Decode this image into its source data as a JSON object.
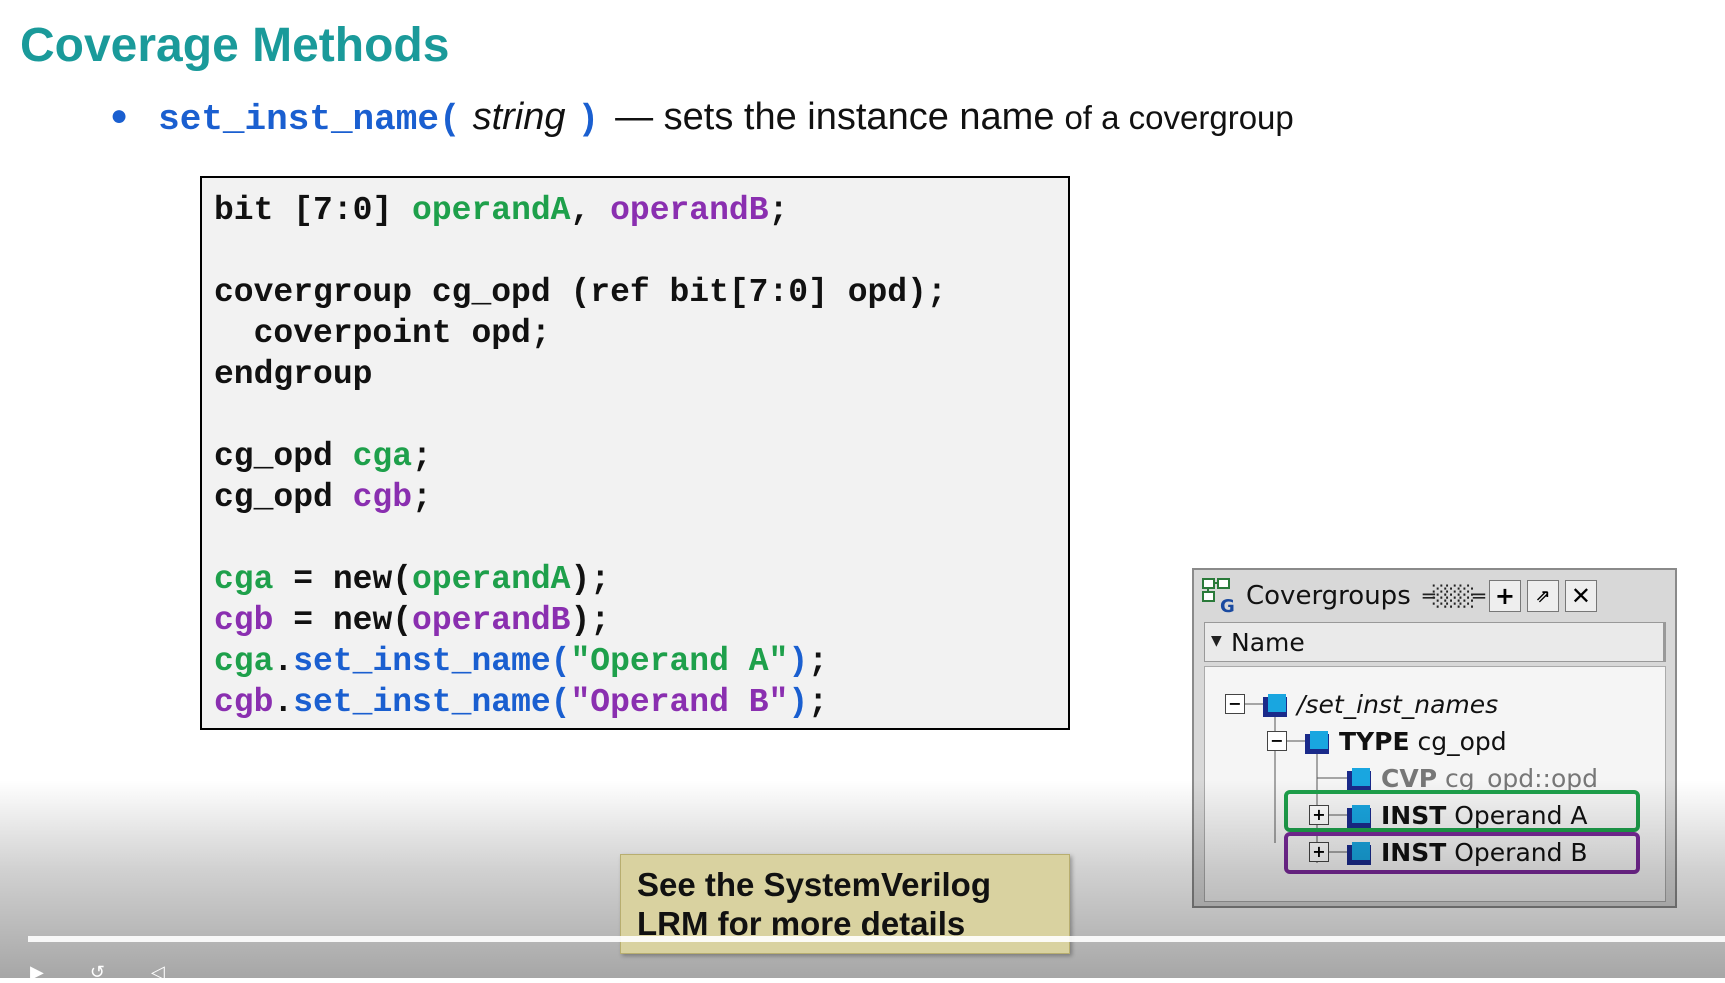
{
  "slide": {
    "title": "Coverage Methods",
    "bullet": {
      "method": "set_inst_name(",
      "arg": "string",
      "close": ")",
      "desc": "— sets the instance name",
      "desc_small": "of a covergroup"
    }
  },
  "code": {
    "l1_a": "bit [7:0] ",
    "l1_opA": "operandA",
    "l1_comma": ", ",
    "l1_opB": "operandB",
    "l1_end": ";",
    "l3": "covergroup cg_opd (ref bit[7:0] opd);",
    "l4": "  coverpoint opd;",
    "l5": "endgroup",
    "l7_type": "cg_opd ",
    "l7_var": "cga",
    "l7_end": ";",
    "l8_type": "cg_opd ",
    "l8_var": "cgb",
    "l8_end": ";",
    "l10_var": "cga",
    "l10_mid": " = new(",
    "l10_arg": "operandA",
    "l10_end": ");",
    "l11_var": "cgb",
    "l11_mid": " = new(",
    "l11_arg": "operandB",
    "l11_end": ");",
    "l12_var": "cga",
    "l12_dot": ".",
    "l12_m": "set_inst_name(",
    "l12_str": "\"Operand A\"",
    "l12_close": ")",
    "l12_end": ";",
    "l13_var": "cgb",
    "l13_dot": ".",
    "l13_m": "set_inst_name(",
    "l13_str": "\"Operand B\"",
    "l13_close": ")",
    "l13_end": ";"
  },
  "note": {
    "text_line1": "See the SystemVerilog",
    "text_line2": "LRM for more details"
  },
  "panel": {
    "title": "Covergroups",
    "column": "Name",
    "rows": [
      {
        "label": "/set_inst_names",
        "expander": "−"
      },
      {
        "prefix": "TYPE",
        "label": "cg_opd",
        "expander": "−"
      },
      {
        "prefix": "CVP",
        "label": "cg_opd::opd"
      },
      {
        "prefix": "INST",
        "label": "Operand A",
        "expander": "+"
      },
      {
        "prefix": "INST",
        "label": "Operand B",
        "expander": "+"
      }
    ]
  },
  "colors": {
    "title": "#1a9a9a",
    "method_blue": "#1a5fd0",
    "operandA_green": "#1ea04b",
    "operandB_purple": "#8a2fb0",
    "note_bg": "#d9d2a0"
  }
}
